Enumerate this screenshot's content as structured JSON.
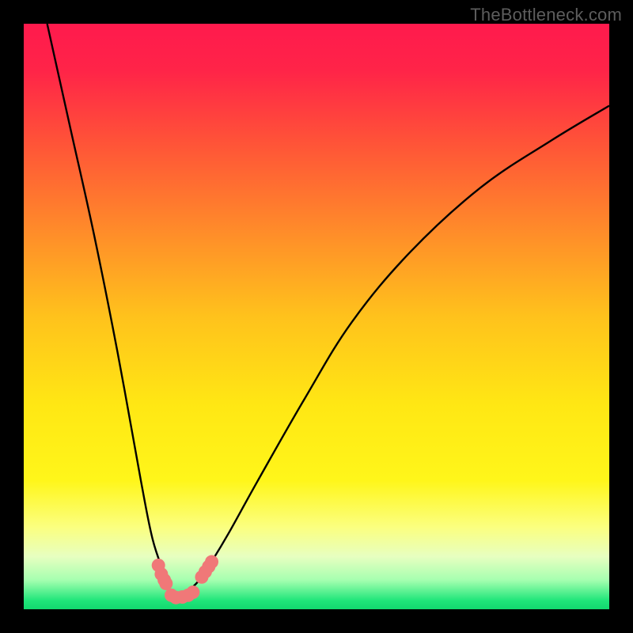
{
  "watermark": "TheBottleneck.com",
  "chart_data": {
    "type": "line",
    "title": "",
    "xlabel": "",
    "ylabel": "",
    "xlim": [
      0,
      100
    ],
    "ylim": [
      0,
      100
    ],
    "grid": false,
    "legend": false,
    "gradient_stops": [
      {
        "pos": 0.0,
        "color": "#ff1a4d"
      },
      {
        "pos": 0.08,
        "color": "#ff2448"
      },
      {
        "pos": 0.2,
        "color": "#ff5238"
      },
      {
        "pos": 0.35,
        "color": "#ff8a2a"
      },
      {
        "pos": 0.5,
        "color": "#ffc21c"
      },
      {
        "pos": 0.65,
        "color": "#ffe714"
      },
      {
        "pos": 0.78,
        "color": "#fff61a"
      },
      {
        "pos": 0.86,
        "color": "#fbff80"
      },
      {
        "pos": 0.91,
        "color": "#e7ffc0"
      },
      {
        "pos": 0.95,
        "color": "#a6ffb0"
      },
      {
        "pos": 0.985,
        "color": "#20e67a"
      },
      {
        "pos": 1.0,
        "color": "#12d96f"
      }
    ],
    "series": [
      {
        "name": "bottleneck-curve",
        "x": [
          4,
          8,
          12,
          16,
          20,
          22,
          24,
          25,
          26,
          27,
          28,
          30,
          32,
          35,
          40,
          48,
          56,
          66,
          78,
          90,
          100
        ],
        "y": [
          100,
          82,
          64,
          44,
          22,
          12,
          6,
          3,
          2,
          2,
          3,
          5,
          8,
          13,
          22,
          36,
          49,
          61,
          72,
          80,
          86
        ]
      }
    ],
    "markers": [
      {
        "name": "left-cluster",
        "x": [
          23.0,
          23.5,
          24.0,
          24.3
        ],
        "y": [
          7.5,
          6.0,
          5.0,
          4.4
        ]
      },
      {
        "name": "trough-cluster",
        "x": [
          25.2,
          26.0,
          27.1,
          28.1,
          28.9
        ],
        "y": [
          2.4,
          2.0,
          2.1,
          2.4,
          2.9
        ]
      },
      {
        "name": "right-cluster",
        "x": [
          30.4,
          31.0,
          31.6,
          32.1
        ],
        "y": [
          5.5,
          6.4,
          7.3,
          8.1
        ]
      }
    ],
    "marker_color": "#f07878",
    "curve_color": "#000000"
  }
}
